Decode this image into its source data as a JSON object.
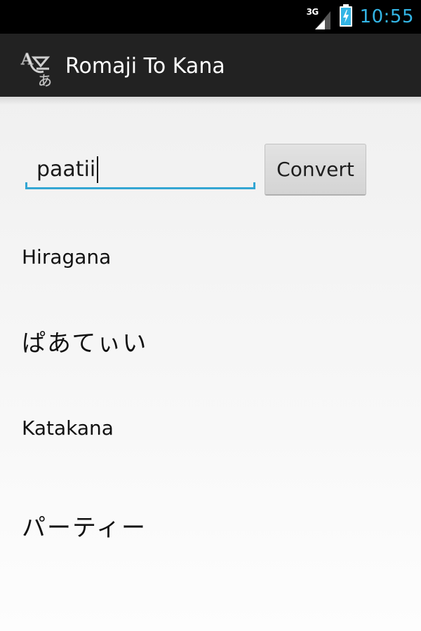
{
  "status_bar": {
    "network": "3G",
    "time": "10:55",
    "clock_color": "#33b5e5",
    "icons": [
      "signal-icon",
      "battery-charging-icon"
    ]
  },
  "action_bar": {
    "app_icon": "romaji-kana-app-icon",
    "title": "Romaji To Kana"
  },
  "form": {
    "input_value": "paatii",
    "input_accent": "#33a6d3",
    "convert_label": "Convert"
  },
  "results": {
    "hiragana_label": "Hiragana",
    "hiragana_value": "ぱあてぃい",
    "katakana_label": "Katakana",
    "katakana_value": "パーティー"
  }
}
